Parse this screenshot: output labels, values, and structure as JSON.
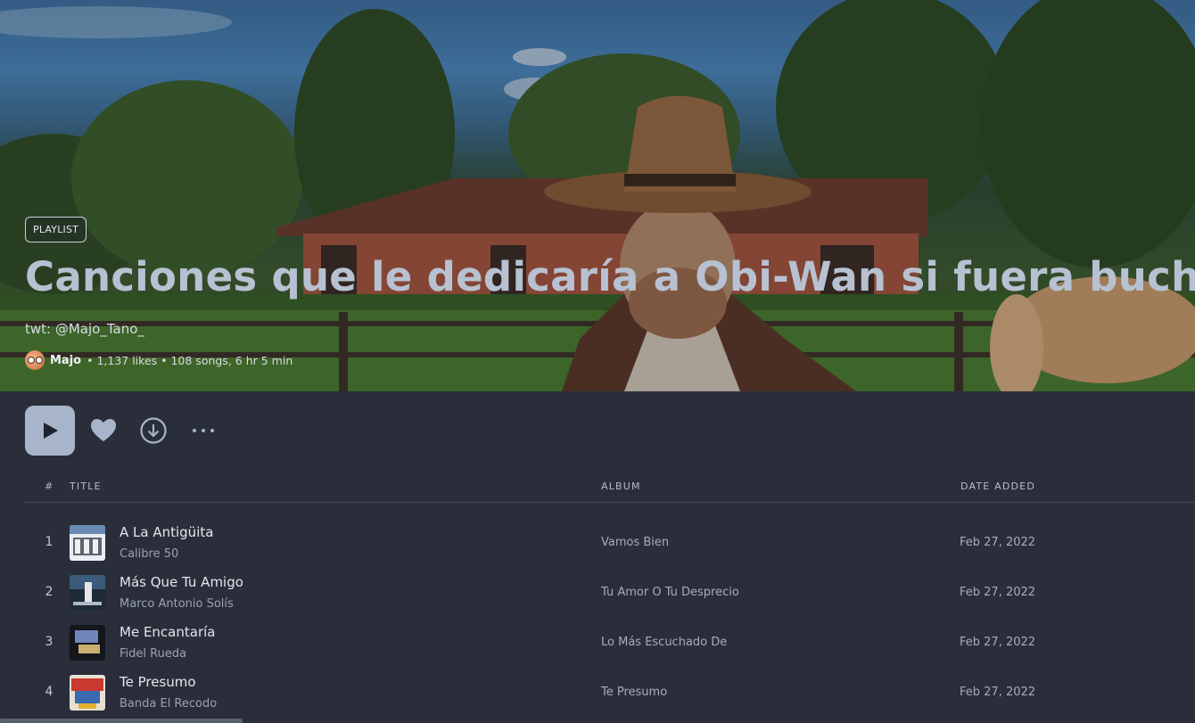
{
  "hero": {
    "badge": "PLAYLIST",
    "title": "Canciones que le dedicaría a Obi-Wan si fuera buchón",
    "description": "twt: @Majo_Tano_",
    "owner": "Majo",
    "stats": "• 1,137 likes • 108 songs, 6 hr 5 min"
  },
  "controls": {
    "play_icon": "play-icon",
    "like_icon": "heart-icon",
    "download_icon": "download-icon",
    "more_icon": "more-icon",
    "accent": "#a7b4c9"
  },
  "table": {
    "headers": {
      "num": "#",
      "title": "TITLE",
      "album": "ALBUM",
      "date": "DATE ADDED"
    },
    "rows": [
      {
        "num": "1",
        "title": "A La Antigüita",
        "artist": "Calibre 50",
        "album": "Vamos Bien",
        "date": "Feb 27, 2022"
      },
      {
        "num": "2",
        "title": "Más Que Tu Amigo",
        "artist": "Marco Antonio Solís",
        "album": "Tu Amor O Tu Desprecio",
        "date": "Feb 27, 2022"
      },
      {
        "num": "3",
        "title": "Me Encantaría",
        "artist": "Fidel Rueda",
        "album": "Lo Más Escuchado De",
        "date": "Feb 27, 2022"
      },
      {
        "num": "4",
        "title": "Te Presumo",
        "artist": "Banda El Recodo",
        "album": "Te Presumo",
        "date": "Feb 27, 2022"
      }
    ]
  }
}
